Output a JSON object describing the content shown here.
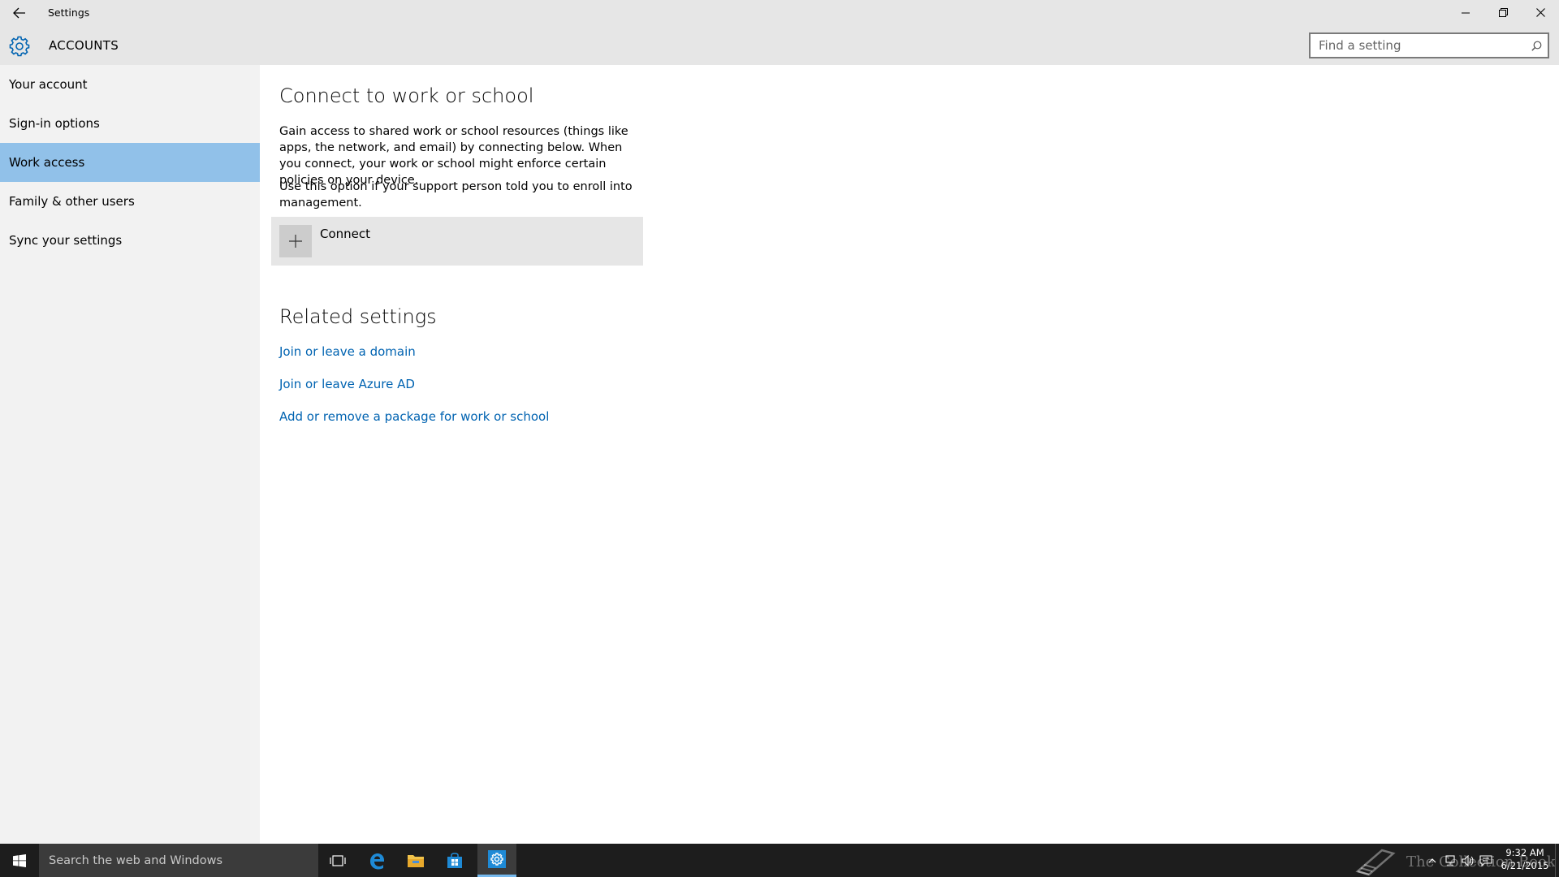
{
  "window": {
    "title": "Settings"
  },
  "header": {
    "section": "ACCOUNTS",
    "search_placeholder": "Find a setting"
  },
  "sidebar": {
    "items": [
      {
        "label": "Your account"
      },
      {
        "label": "Sign-in options"
      },
      {
        "label": "Work access",
        "selected": true
      },
      {
        "label": "Family & other users"
      },
      {
        "label": "Sync your settings"
      }
    ]
  },
  "main": {
    "title": "Connect to work or school",
    "desc1": "Gain access to shared work or school resources (things like apps, the network, and email) by connecting below. When you connect, your work or school might enforce certain policies on your device.",
    "desc2": "Use this option if your support person told you to enroll into management.",
    "connect_label": "Connect",
    "related_title": "Related settings",
    "links": [
      "Join or leave a domain",
      "Join or leave Azure AD",
      "Add or remove a package for work or school"
    ]
  },
  "taskbar": {
    "search_text": "Search the web and Windows",
    "watermark": "The Collection Book",
    "time": "9:32 AM",
    "date": "6/21/2015",
    "icons": [
      "task-view-icon",
      "edge-icon",
      "file-explorer-icon",
      "store-icon",
      "settings-icon"
    ]
  },
  "colors": {
    "accent": "#0063b1",
    "selected_nav": "#91c1e9",
    "chrome": "#e6e6e6",
    "sidebar": "#f2f2f2",
    "taskbar": "#1d1d1d"
  }
}
